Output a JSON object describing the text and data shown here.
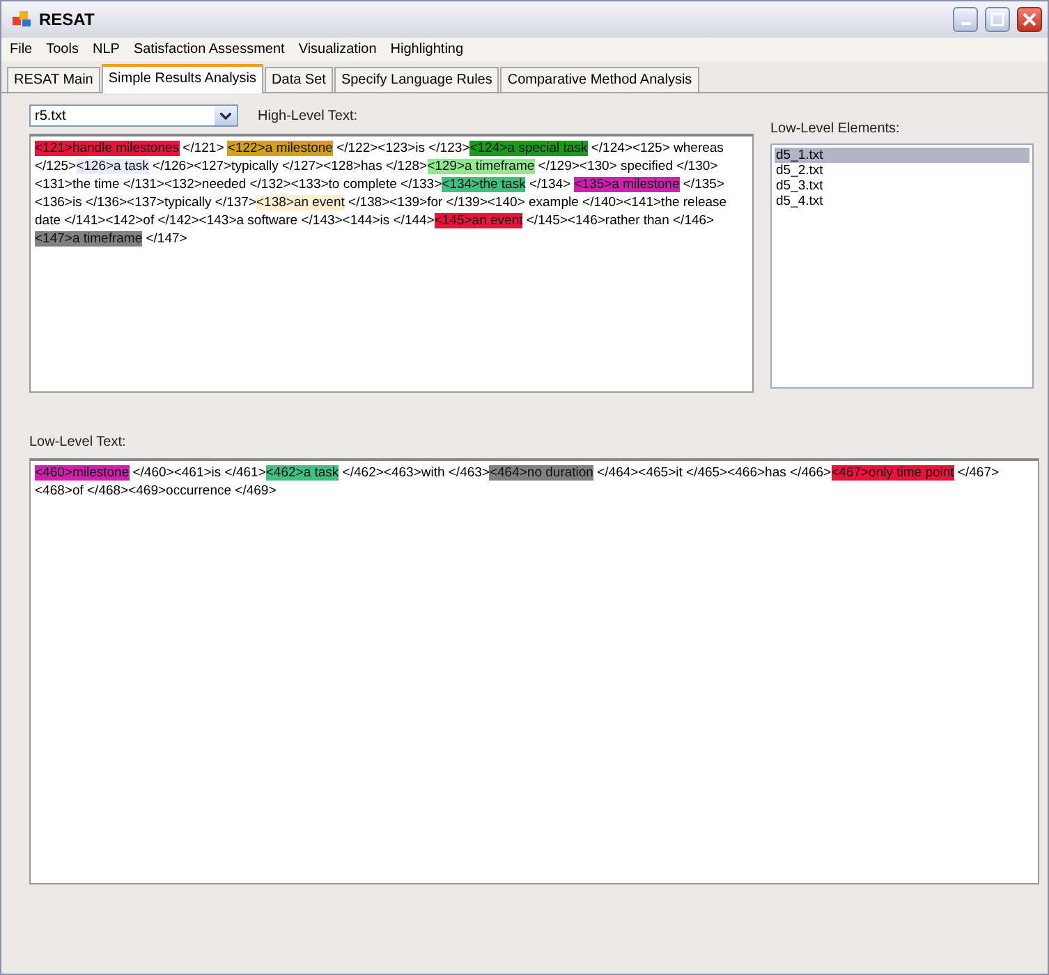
{
  "window": {
    "title": "RESAT"
  },
  "menu": [
    "File",
    "Tools",
    "NLP",
    "Satisfaction Assessment",
    "Visualization",
    "Highlighting"
  ],
  "tabs": [
    {
      "label": "RESAT Main",
      "selected": false
    },
    {
      "label": "Simple Results Analysis",
      "selected": true
    },
    {
      "label": "Data Set",
      "selected": false
    },
    {
      "label": "Specify Language Rules",
      "selected": false
    },
    {
      "label": "Comparative Method Analysis",
      "selected": false
    }
  ],
  "file_select": {
    "value": "r5.txt"
  },
  "high_level": {
    "label": "High-Level Text:",
    "segments": [
      {
        "text": "<121>handle milestones",
        "color": "#e8143c"
      },
      {
        "text": " </121> "
      },
      {
        "text": "<122>a milestone",
        "color": "#d4a017"
      },
      {
        "text": " </122><123>is </123>"
      },
      {
        "text": "<124>a special task",
        "color": "#1a9a1a"
      },
      {
        "text": " </124><125> whereas </125>"
      },
      {
        "text": "<126>a task",
        "color": "#e8eaf6"
      },
      {
        "text": " </126><127>typically </127><128>has </128>"
      },
      {
        "text": "<129>a timeframe",
        "color": "#90e890"
      },
      {
        "text": " </129><130> specified </130><131>the time </131><132>needed </132><133>to complete </133>"
      },
      {
        "text": "<134>the task",
        "color": "#40c080"
      },
      {
        "text": " </134> "
      },
      {
        "text": "<135>a milestone",
        "color": "#d020b0"
      },
      {
        "text": " </135><136>is </136><137>typically </137>"
      },
      {
        "text": "<138>an event",
        "color": "#fdf0d0"
      },
      {
        "text": " </138><139>for </139><140> example </140><141>the release date </141><142>of </142><143>a software </143><144>is </144>"
      },
      {
        "text": "<145>an event",
        "color": "#e8143c"
      },
      {
        "text": " </145><146>rather than </146>"
      },
      {
        "text": "<147>a timeframe",
        "color": "#808080"
      },
      {
        "text": " </147>"
      }
    ]
  },
  "low_level_elements": {
    "label": "Low-Level Elements:",
    "items": [
      {
        "label": "d5_1.txt",
        "selected": true
      },
      {
        "label": "d5_2.txt",
        "selected": false
      },
      {
        "label": "d5_3.txt",
        "selected": false
      },
      {
        "label": "d5_4.txt",
        "selected": false
      }
    ]
  },
  "low_level": {
    "label": "Low-Level Text:",
    "segments": [
      {
        "text": "<460>milestone",
        "color": "#d020b0"
      },
      {
        "text": " </460><461>is </461>"
      },
      {
        "text": "<462>a task",
        "color": "#40c080"
      },
      {
        "text": " </462><463>with </463>"
      },
      {
        "text": "<464>no duration",
        "color": "#808080"
      },
      {
        "text": " </464><465>it </465><466>has </466>"
      },
      {
        "text": "<467>only time point",
        "color": "#e8143c"
      },
      {
        "text": " </467><468>of </468><469>occurrence </469>"
      }
    ]
  }
}
